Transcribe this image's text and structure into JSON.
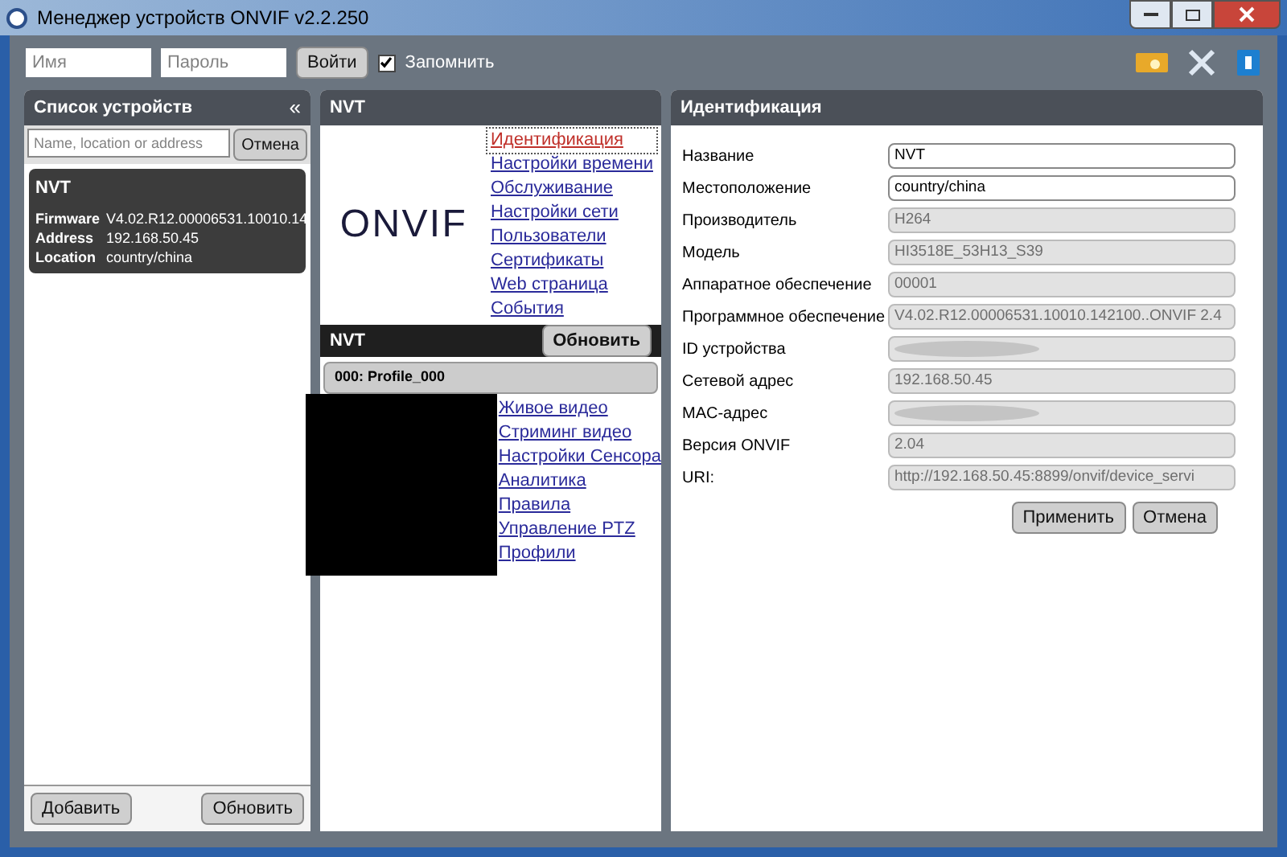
{
  "window": {
    "title": "Менеджер устройств ONVIF v2.2.250"
  },
  "login": {
    "name_placeholder": "Имя",
    "password_placeholder": "Пароль",
    "button": "Войти",
    "remember": {
      "label": "Запомнить",
      "checked": true
    }
  },
  "devices_panel": {
    "title": "Список устройств",
    "collapse": "«",
    "search_placeholder": "Name, location or address",
    "cancel": "Отмена",
    "devices": [
      {
        "name": "NVT",
        "selected": true,
        "fields": [
          {
            "label": "Firmware",
            "value": "V4.02.R12.00006531.10010.14"
          },
          {
            "label": "Address",
            "value": "192.168.50.45"
          },
          {
            "label": "Location",
            "value": "country/china"
          }
        ]
      }
    ],
    "buttons": [
      "Добавить",
      "Обновить"
    ]
  },
  "device_panel": {
    "title": "NVT",
    "logo": "ONVIF",
    "links": [
      {
        "label": "Идентификация",
        "selected": true
      },
      {
        "label": "Настройки времени",
        "selected": false
      },
      {
        "label": "Обслуживание",
        "selected": false
      },
      {
        "label": "Настройки сети",
        "selected": false
      },
      {
        "label": "Пользователи",
        "selected": false
      },
      {
        "label": "Сертификаты",
        "selected": false
      },
      {
        "label": "Web страница",
        "selected": false
      },
      {
        "label": "События",
        "selected": false
      }
    ],
    "section": {
      "title": "NVT",
      "button": "Обновить"
    },
    "profile": "000: Profile_000",
    "profile_links": [
      "Живое видео",
      "Стриминг видео",
      "Настройки Сенсора",
      "Аналитика",
      "Правила",
      "Управление PTZ",
      "Профили"
    ]
  },
  "identification_panel": {
    "title": "Идентификация",
    "fields": [
      {
        "label": "Название",
        "value": "NVT",
        "editable": true,
        "redacted": false
      },
      {
        "label": "Местоположение",
        "value": "country/china",
        "editable": true,
        "redacted": false
      },
      {
        "label": "Производитель",
        "value": "H264",
        "editable": false,
        "redacted": false
      },
      {
        "label": "Модель",
        "value": "HI3518E_53H13_S39",
        "editable": false,
        "redacted": false
      },
      {
        "label": "Аппаратное обеспечение",
        "value": "00001",
        "editable": false,
        "redacted": false
      },
      {
        "label": "Программное обеспечение",
        "value": "V4.02.R12.00006531.10010.142100..ONVIF 2.4",
        "editable": false,
        "redacted": false
      },
      {
        "label": "ID устройства",
        "editable": false,
        "redacted": true
      },
      {
        "label": "Сетевой адрес",
        "value": "192.168.50.45",
        "editable": false,
        "redacted": false
      },
      {
        "label": "MAC-адрес",
        "editable": false,
        "redacted": true
      },
      {
        "label": "Версия ONVIF",
        "value": "2.04",
        "editable": false,
        "redacted": false
      },
      {
        "label": "URI:",
        "value": "http://192.168.50.45:8899/onvif/device_servi",
        "editable": false,
        "redacted": false
      }
    ],
    "buttons": [
      "Применить",
      "Отмена"
    ]
  }
}
